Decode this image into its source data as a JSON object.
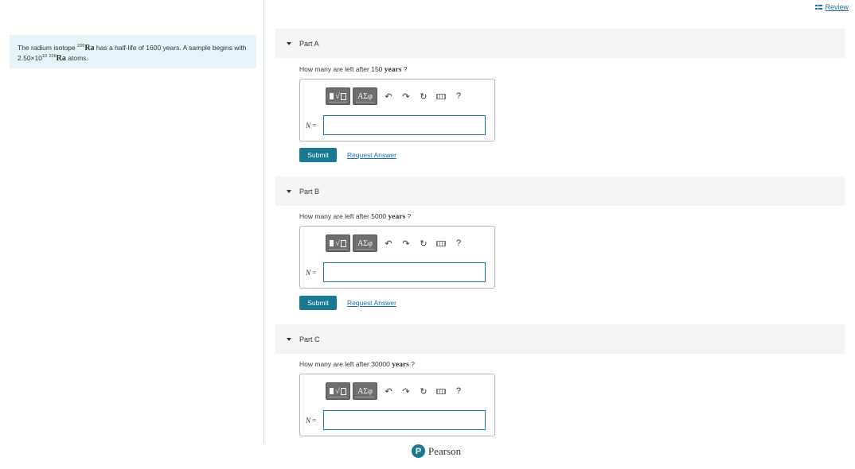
{
  "review": {
    "label": "Review"
  },
  "problem": {
    "text_1": "The radium isotope ",
    "isotope_mass": "226",
    "isotope_symbol": "Ra",
    "text_2": " has a half-life of 1600 years. A sample begins with 2.50×10",
    "exponent": "10",
    "isotope_mass_2": "226",
    "isotope_symbol_2": "Ra",
    "text_3": " atoms."
  },
  "toolbar": {
    "templates_label": "√",
    "symbols_label": "ΑΣφ",
    "undo_icon": "undo-icon",
    "redo_icon": "redo-icon",
    "reset_icon": "reset-icon",
    "keyboard_icon": "keyboard-icon",
    "help_label": "?"
  },
  "parts": [
    {
      "title": "Part A",
      "question_prefix": "How many are left after 150 ",
      "question_unit": "years",
      "question_suffix": " ?",
      "variable": "N",
      "equals": "=",
      "value": "",
      "submit_label": "Submit",
      "request_label": "Request Answer"
    },
    {
      "title": "Part B",
      "question_prefix": "How many are left after 5000 ",
      "question_unit": "years",
      "question_suffix": " ?",
      "variable": "N",
      "equals": "=",
      "value": "",
      "submit_label": "Submit",
      "request_label": "Request Answer"
    },
    {
      "title": "Part C",
      "question_prefix": "How many are left after 30000 ",
      "question_unit": "years",
      "question_suffix": " ?",
      "variable": "N",
      "equals": "=",
      "value": ""
    }
  ],
  "footer": {
    "brand": "Pearson",
    "logo_letter": "P"
  },
  "colors": {
    "accent": "#1a7891",
    "link": "#1a6fa8",
    "problem_bg": "#e6f4f8",
    "header_bg": "#f4f4f4"
  }
}
